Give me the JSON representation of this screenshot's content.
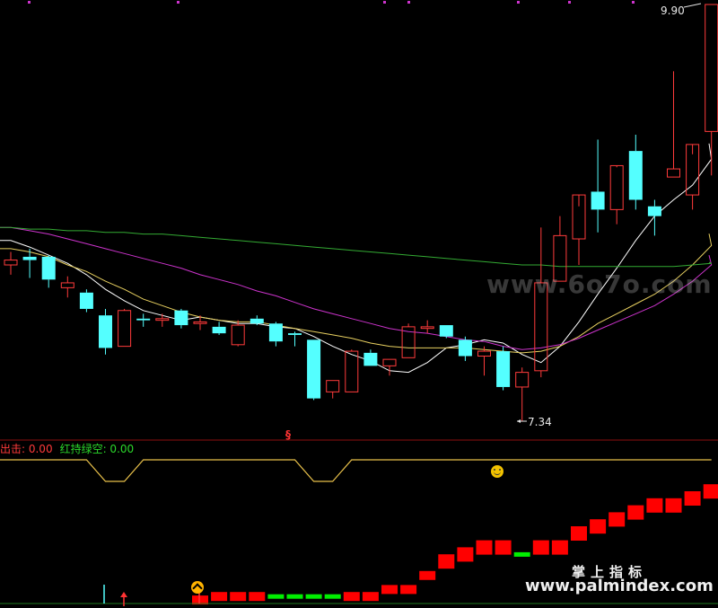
{
  "legend": {
    "item1": "出击: 0.00",
    "item2": "红持绿空: 0.00"
  },
  "annotations": {
    "high": "9.90",
    "low": "7.34"
  },
  "watermark": {
    "site_stylized": "www.6o7o.com",
    "cn_name": "掌上指标",
    "site": "www.palmindex.com"
  },
  "colors": {
    "up": "#ff3b3b",
    "down": "#54ffff",
    "ma5": "#ffffff",
    "ma10": "#e8d060",
    "ma20": "#cc33cc",
    "ma60": "#33aa33",
    "signal_line": "#e8c04a",
    "bar_red": "#ff0000",
    "bar_green": "#00ee00",
    "top_marks": "#cc33cc"
  },
  "icons": [
    "smiley-icon",
    "sell-signal-icon",
    "buy-arrow-icon",
    "hat-icon"
  ],
  "chart_data": [
    {
      "type": "candlestick",
      "title": "",
      "annotations": [
        {
          "text": "9.90",
          "kind": "high"
        },
        {
          "text": "7.34",
          "kind": "low"
        }
      ],
      "ylim": [
        7.2,
        10.0
      ],
      "candles": [
        {
          "o": 8.3,
          "h": 8.38,
          "l": 8.24,
          "c": 8.33
        },
        {
          "o": 8.35,
          "h": 8.4,
          "l": 8.22,
          "c": 8.33
        },
        {
          "o": 8.35,
          "h": 8.36,
          "l": 8.16,
          "c": 8.21
        },
        {
          "o": 8.16,
          "h": 8.23,
          "l": 8.1,
          "c": 8.19
        },
        {
          "o": 8.13,
          "h": 8.15,
          "l": 8.01,
          "c": 8.03
        },
        {
          "o": 7.99,
          "h": 8.03,
          "l": 7.75,
          "c": 7.79
        },
        {
          "o": 7.8,
          "h": 8.03,
          "l": 7.8,
          "c": 8.02
        },
        {
          "o": 7.97,
          "h": 8.0,
          "l": 7.92,
          "c": 7.96
        },
        {
          "o": 7.96,
          "h": 8.0,
          "l": 7.92,
          "c": 7.97
        },
        {
          "o": 8.02,
          "h": 8.03,
          "l": 7.91,
          "c": 7.93
        },
        {
          "o": 7.94,
          "h": 7.99,
          "l": 7.9,
          "c": 7.95
        },
        {
          "o": 7.92,
          "h": 7.95,
          "l": 7.87,
          "c": 7.88
        },
        {
          "o": 7.81,
          "h": 7.96,
          "l": 7.8,
          "c": 7.93
        },
        {
          "o": 7.97,
          "h": 7.99,
          "l": 7.93,
          "c": 7.94
        },
        {
          "o": 7.94,
          "h": 7.95,
          "l": 7.8,
          "c": 7.83
        },
        {
          "o": 7.88,
          "h": 7.89,
          "l": 7.8,
          "c": 7.87
        },
        {
          "o": 7.84,
          "h": 7.84,
          "l": 7.47,
          "c": 7.48
        },
        {
          "o": 7.52,
          "h": 7.59,
          "l": 7.48,
          "c": 7.59
        },
        {
          "o": 7.52,
          "h": 7.78,
          "l": 7.52,
          "c": 7.77
        },
        {
          "o": 7.76,
          "h": 7.78,
          "l": 7.68,
          "c": 7.68
        },
        {
          "o": 7.68,
          "h": 7.72,
          "l": 7.62,
          "c": 7.72
        },
        {
          "o": 7.73,
          "h": 7.94,
          "l": 7.73,
          "c": 7.92
        },
        {
          "o": 7.91,
          "h": 7.96,
          "l": 7.88,
          "c": 7.92
        },
        {
          "o": 7.93,
          "h": 7.93,
          "l": 7.85,
          "c": 7.86
        },
        {
          "o": 7.84,
          "h": 7.86,
          "l": 7.71,
          "c": 7.74
        },
        {
          "o": 7.74,
          "h": 7.8,
          "l": 7.62,
          "c": 7.77
        },
        {
          "o": 7.77,
          "h": 7.8,
          "l": 7.53,
          "c": 7.55
        },
        {
          "o": 7.55,
          "h": 7.67,
          "l": 7.34,
          "c": 7.64
        },
        {
          "o": 7.65,
          "h": 8.53,
          "l": 7.61,
          "c": 8.19
        },
        {
          "o": 8.2,
          "h": 8.6,
          "l": 8.2,
          "c": 8.48
        },
        {
          "o": 8.46,
          "h": 8.66,
          "l": 8.3,
          "c": 8.73
        },
        {
          "o": 8.75,
          "h": 9.07,
          "l": 8.5,
          "c": 8.64
        },
        {
          "o": 8.64,
          "h": 8.9,
          "l": 8.55,
          "c": 8.91
        },
        {
          "o": 9.0,
          "h": 9.1,
          "l": 8.64,
          "c": 8.7
        },
        {
          "o": 8.66,
          "h": 8.7,
          "l": 8.48,
          "c": 8.6
        },
        {
          "o": 8.84,
          "h": 9.49,
          "l": 8.84,
          "c": 8.89
        },
        {
          "o": 8.73,
          "h": 8.98,
          "l": 8.64,
          "c": 9.04
        },
        {
          "o": 9.12,
          "h": 9.9,
          "l": 8.85,
          "c": 9.9
        }
      ],
      "moving_averages": [
        {
          "name": "MA5",
          "values": [
            8.45,
            8.41,
            8.36,
            8.31,
            8.24,
            8.15,
            8.08,
            8.02,
            7.99,
            7.96,
            7.98,
            7.96,
            7.94,
            7.94,
            7.92,
            7.91,
            7.86,
            7.8,
            7.75,
            7.71,
            7.65,
            7.64,
            7.7,
            7.79,
            7.81,
            7.84,
            7.82,
            7.75,
            7.7,
            7.8,
            7.95,
            8.12,
            8.28,
            8.45,
            8.6,
            8.7,
            8.79,
            8.95
          ]
        },
        {
          "name": "MA10",
          "values": [
            8.4,
            8.38,
            8.35,
            8.3,
            8.26,
            8.2,
            8.15,
            8.09,
            8.05,
            8.01,
            7.98,
            7.96,
            7.95,
            7.95,
            7.93,
            7.91,
            7.89,
            7.87,
            7.85,
            7.82,
            7.8,
            7.79,
            7.79,
            7.79,
            7.79,
            7.78,
            7.77,
            7.76,
            7.77,
            7.8,
            7.86,
            7.94,
            8.0,
            8.06,
            8.12,
            8.2,
            8.3,
            8.42
          ]
        },
        {
          "name": "MA20",
          "values": [
            8.53,
            8.51,
            8.49,
            8.46,
            8.43,
            8.4,
            8.37,
            8.34,
            8.31,
            8.28,
            8.24,
            8.21,
            8.18,
            8.14,
            8.11,
            8.07,
            8.03,
            8.0,
            7.97,
            7.94,
            7.91,
            7.89,
            7.88,
            7.86,
            7.84,
            7.83,
            7.8,
            7.78,
            7.79,
            7.81,
            7.85,
            7.9,
            7.95,
            8.0,
            8.05,
            8.12,
            8.2,
            8.3
          ]
        },
        {
          "name": "MA60",
          "values": [
            8.53,
            8.52,
            8.52,
            8.51,
            8.51,
            8.5,
            8.5,
            8.49,
            8.49,
            8.48,
            8.47,
            8.46,
            8.45,
            8.44,
            8.43,
            8.42,
            8.41,
            8.4,
            8.39,
            8.38,
            8.37,
            8.36,
            8.35,
            8.34,
            8.33,
            8.32,
            8.31,
            8.3,
            8.3,
            8.29,
            8.29,
            8.29,
            8.29,
            8.29,
            8.29,
            8.29,
            8.3,
            8.31
          ]
        }
      ]
    },
    {
      "type": "line",
      "series": [
        {
          "name": "红持绿空",
          "values": [
            1,
            1,
            1,
            1,
            1,
            0,
            0,
            1,
            1,
            1,
            1,
            1,
            1,
            1,
            1,
            1,
            0,
            0,
            1,
            1,
            1,
            1,
            1,
            1,
            1,
            1,
            1,
            1,
            1,
            1,
            1,
            1,
            1,
            1,
            1,
            1,
            1,
            1
          ]
        }
      ]
    },
    {
      "type": "bar",
      "series": [
        {
          "name": "red",
          "values": [
            0,
            0,
            0,
            0,
            0,
            0,
            0,
            0,
            0,
            0,
            0.5,
            1,
            1,
            1,
            0,
            0,
            0,
            0,
            1,
            1,
            2,
            2,
            4,
            6,
            7,
            8,
            8,
            0,
            8,
            8,
            10,
            11,
            12,
            13,
            14,
            14,
            15,
            16
          ]
        },
        {
          "name": "green",
          "values": [
            0,
            0,
            0,
            0,
            0,
            0,
            0,
            0,
            0,
            0,
            0,
            0,
            0,
            0,
            1,
            1,
            1,
            1,
            0,
            0,
            0,
            0,
            0,
            0,
            0,
            0,
            0,
            7,
            0,
            0,
            0,
            0,
            0,
            0,
            0,
            0,
            0,
            0
          ]
        }
      ]
    }
  ]
}
